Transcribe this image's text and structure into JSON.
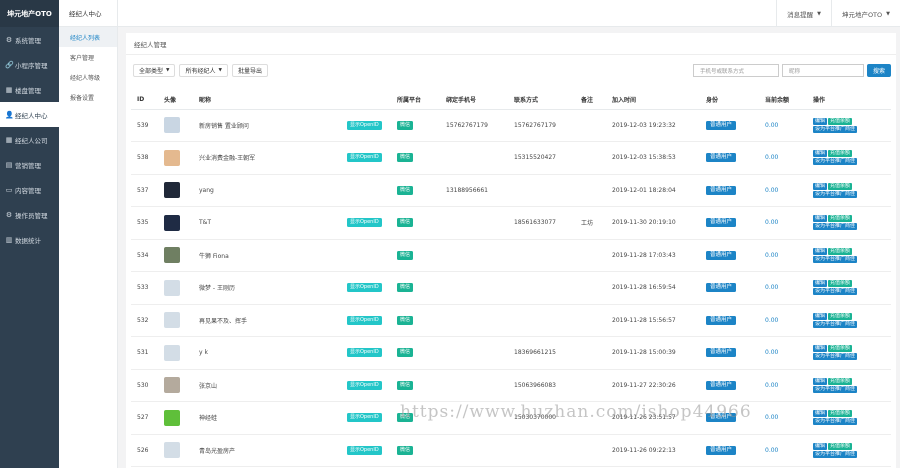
{
  "brand": "坤元地产OTO",
  "nav": [
    {
      "icon": "⚙",
      "name": "settings-icon",
      "label": "系统管理"
    },
    {
      "icon": "🔗",
      "name": "link-icon",
      "label": "小程序管理"
    },
    {
      "icon": "▦",
      "name": "building-icon",
      "label": "楼盘管理"
    },
    {
      "icon": "👤",
      "name": "user-icon",
      "label": "经纪人中心"
    },
    {
      "icon": "▦",
      "name": "company-icon",
      "label": "经纪人公司"
    },
    {
      "icon": "▤",
      "name": "marketing-icon",
      "label": "营销管理"
    },
    {
      "icon": "▭",
      "name": "content-icon",
      "label": "内容管理"
    },
    {
      "icon": "⚙",
      "name": "gear-icon",
      "label": "操作员管理"
    },
    {
      "icon": "▥",
      "name": "chart-icon",
      "label": "数据统计"
    }
  ],
  "subnav": {
    "title": "经纪人中心",
    "items": [
      "经纪人列表",
      "客户管理",
      "经纪人等级",
      "报备设置"
    ]
  },
  "topbar": {
    "msg": "消息提醒",
    "user": "坤元地产OTO"
  },
  "panel_title": "经纪人管理",
  "filters": {
    "type": "全部类型",
    "agent": "所有经纪人",
    "export": "批量导出"
  },
  "search": {
    "phone": "手机号或联系方式",
    "nick": "昵称",
    "btn": "搜索"
  },
  "headers": [
    "ID",
    "头像",
    "昵称",
    "",
    "所属平台",
    "绑定手机号",
    "联系方式",
    "备注",
    "加入时间",
    "身份",
    "当前余额",
    "操作"
  ],
  "badges": {
    "openid": "显示OpenID",
    "wx": "微信",
    "user": "普通用户"
  },
  "ops": {
    "edit": "编辑",
    "recharge": "充值余额",
    "promoter": "设为平台推广商佳"
  },
  "rows": [
    {
      "id": "539",
      "avatar": "#c9d6e3",
      "nick": "新房销售 置业顾问",
      "openid": true,
      "phone": "15762767179",
      "contact": "15762767179",
      "remark": "",
      "time": "2019-12-03 19:23:32",
      "bal": "0.00"
    },
    {
      "id": "538",
      "avatar": "#e4b98f",
      "nick": "兴业消费金融-王朝军",
      "openid": true,
      "phone": "",
      "contact": "15315520427",
      "remark": "",
      "time": "2019-12-03 15:38:53",
      "bal": "0.00"
    },
    {
      "id": "537",
      "avatar": "#202838",
      "nick": "yang",
      "openid": false,
      "phone": "13188956661",
      "contact": "",
      "remark": "",
      "time": "2019-12-01 18:28:04",
      "bal": "0.00"
    },
    {
      "id": "535",
      "avatar": "#1f2b44",
      "nick": "T&T",
      "openid": true,
      "phone": "",
      "contact": "18561633077",
      "remark": "工坊",
      "time": "2019-11-30 20:19:10",
      "bal": "0.00"
    },
    {
      "id": "534",
      "avatar": "#6f7f62",
      "nick": "牛狮 Fiona",
      "openid": false,
      "phone": "",
      "contact": "",
      "remark": "",
      "time": "2019-11-28 17:03:43",
      "bal": "0.00"
    },
    {
      "id": "533",
      "avatar": "#d3dde6",
      "nick": "微梦 - 王刚历",
      "openid": true,
      "phone": "",
      "contact": "",
      "remark": "",
      "time": "2019-11-28 16:59:54",
      "bal": "0.00"
    },
    {
      "id": "532",
      "avatar": "#d3dde6",
      "nick": "再见果不及、挥手",
      "openid": true,
      "phone": "",
      "contact": "",
      "remark": "",
      "time": "2019-11-28 15:56:57",
      "bal": "0.00"
    },
    {
      "id": "531",
      "avatar": "#d3dde6",
      "nick": "y k",
      "openid": true,
      "phone": "",
      "contact": "18369661215",
      "remark": "",
      "time": "2019-11-28 15:00:39",
      "bal": "0.00"
    },
    {
      "id": "530",
      "avatar": "#b4aa9d",
      "nick": "张京山",
      "openid": true,
      "phone": "",
      "contact": "15063966083",
      "remark": "",
      "time": "2019-11-27 22:30:26",
      "bal": "0.00"
    },
    {
      "id": "527",
      "avatar": "#5fbf3a",
      "nick": "神经蛙",
      "openid": true,
      "phone": "",
      "contact": "15030370000",
      "remark": "",
      "time": "2019-11-26 23:51:57",
      "bal": "0.00"
    },
    {
      "id": "526",
      "avatar": "#d3dde6",
      "nick": "青岛光盈房产",
      "openid": true,
      "phone": "",
      "contact": "",
      "remark": "",
      "time": "2019-11-26 09:22:13",
      "bal": "0.00"
    }
  ],
  "watermark": "https://www.huzhan.com/ishop44966"
}
